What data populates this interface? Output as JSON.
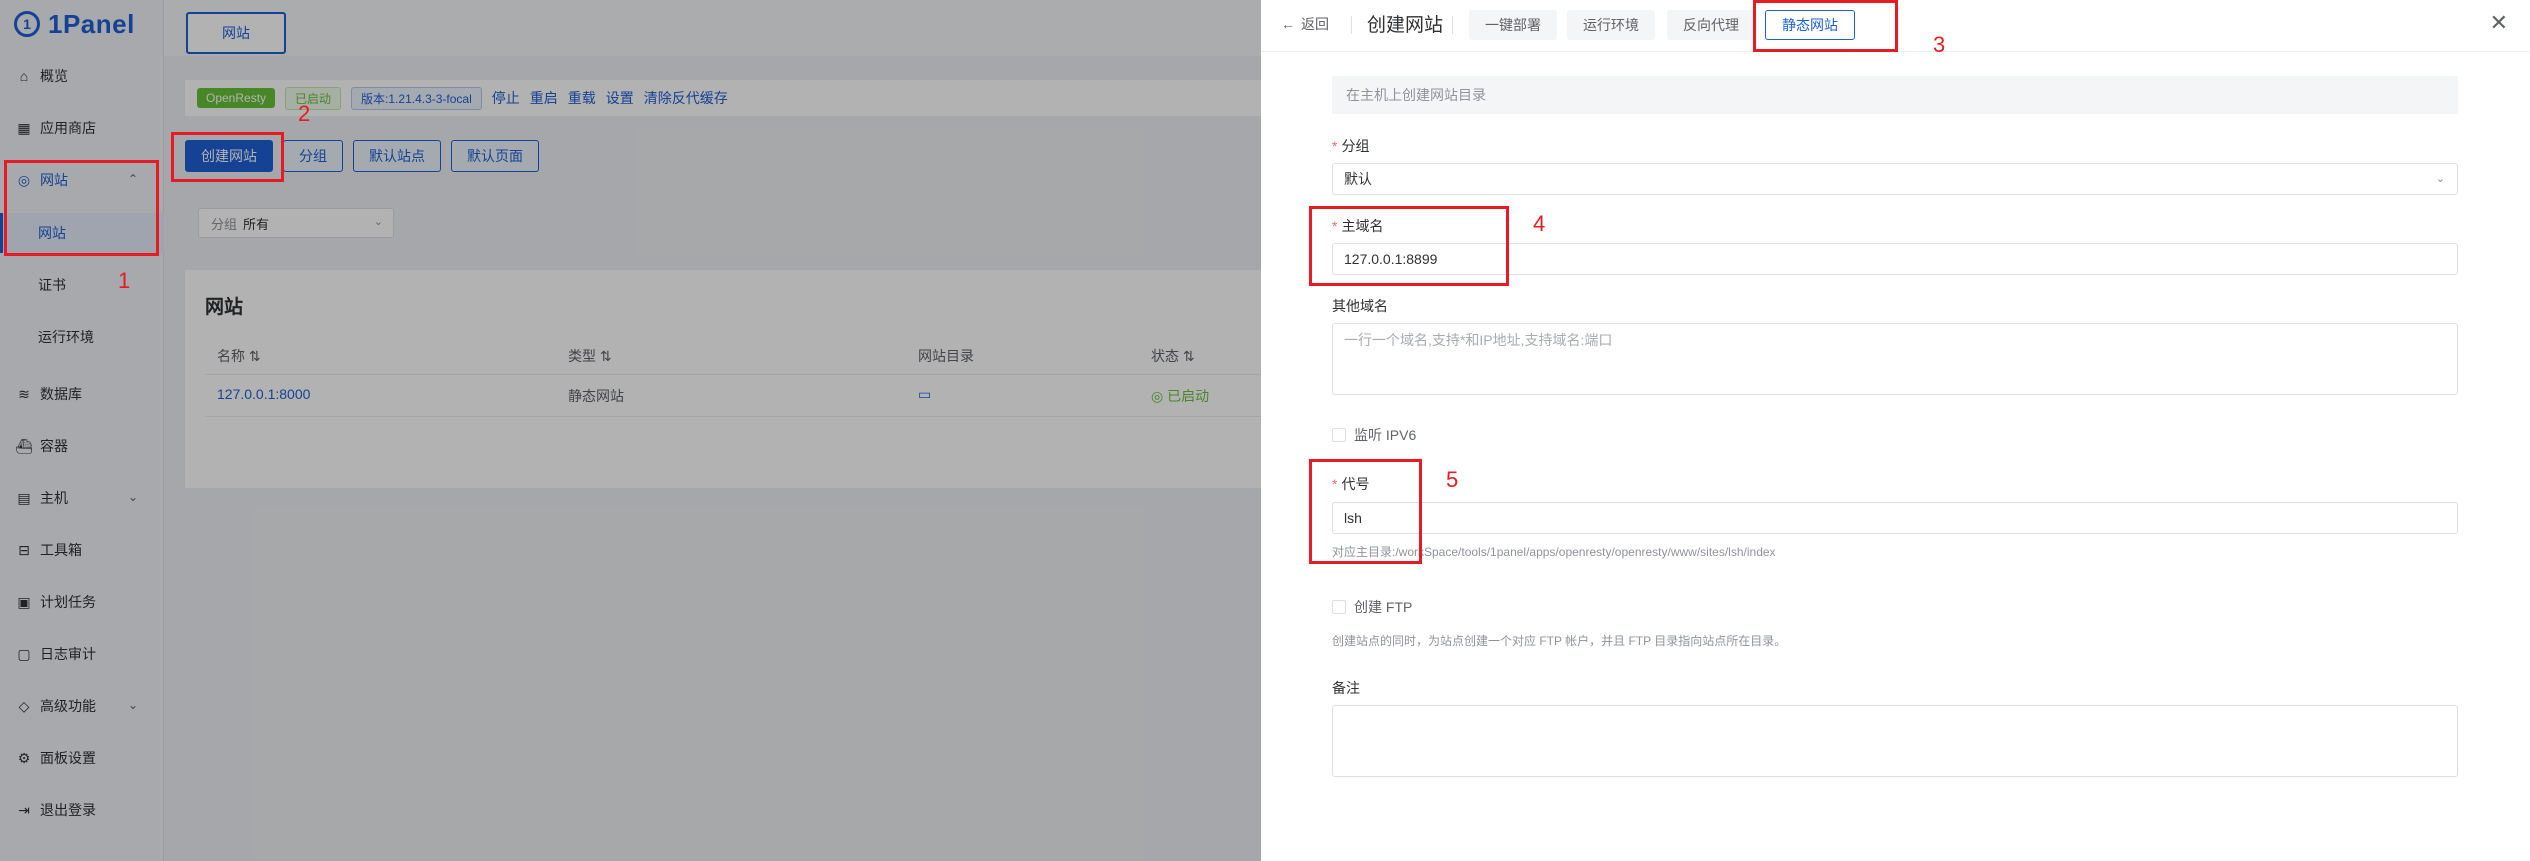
{
  "sidebar": {
    "logo_text": "1Panel",
    "items": [
      {
        "label": "概览",
        "icon": "home-icon"
      },
      {
        "label": "应用商店",
        "icon": "grid-icon"
      },
      {
        "label": "网站",
        "icon": "globe-icon"
      },
      {
        "label": "数据库",
        "icon": "database-icon"
      },
      {
        "label": "容器",
        "icon": "container-icon"
      },
      {
        "label": "主机",
        "icon": "server-icon"
      },
      {
        "label": "工具箱",
        "icon": "toolbox-icon"
      },
      {
        "label": "计划任务",
        "icon": "calendar-icon"
      },
      {
        "label": "日志审计",
        "icon": "log-icon"
      },
      {
        "label": "高级功能",
        "icon": "diamond-icon"
      },
      {
        "label": "面板设置",
        "icon": "gear-icon"
      },
      {
        "label": "退出登录",
        "icon": "logout-icon"
      }
    ],
    "subitems": [
      {
        "label": "网站"
      },
      {
        "label": "证书"
      },
      {
        "label": "运行环境"
      }
    ]
  },
  "main": {
    "top_tab": "网站",
    "status": {
      "app_tag": "OpenResty",
      "state_tag": "已启动",
      "version_tag": "版本:1.21.4.3-3-focal",
      "actions": [
        "停止",
        "重启",
        "重载",
        "设置",
        "清除反代缓存"
      ]
    },
    "buttons": {
      "create": "创建网站",
      "group": "分组",
      "default_site": "默认站点",
      "default_page": "默认页面"
    },
    "group_filter": {
      "label": "分组",
      "value": "所有"
    },
    "list": {
      "title": "网站",
      "columns": [
        "名称",
        "类型",
        "网站目录",
        "状态"
      ],
      "rows": [
        {
          "name": "127.0.0.1:8000",
          "type": "静态网站",
          "status": "已启动"
        }
      ]
    }
  },
  "drawer": {
    "back": "返回",
    "title": "创建网站",
    "tabs": [
      "一键部署",
      "运行环境",
      "反向代理",
      "静态网站"
    ],
    "hint": "在主机上创建网站目录",
    "group": {
      "label": "分组",
      "value": "默认"
    },
    "primary_domain": {
      "label": "主域名",
      "value": "127.0.0.1:8899"
    },
    "other_domains": {
      "label": "其他域名",
      "placeholder": "一行一个域名,支持*和IP地址,支持域名:端口"
    },
    "ipv6": {
      "label": "监听 IPV6"
    },
    "alias": {
      "label": "代号",
      "value": "lsh",
      "help": "对应主目录:/workSpace/tools/1panel/apps/openresty/openresty/www/sites/lsh/index"
    },
    "ftp": {
      "label": "创建 FTP",
      "help": "创建站点的同时，为站点创建一个对应 FTP 帐户，并且 FTP 目录指向站点所在目录。"
    },
    "remark": {
      "label": "备注"
    }
  },
  "annotations": [
    "1",
    "2",
    "3",
    "4",
    "5"
  ],
  "colors": {
    "brand": "#1f5fd6",
    "annotation": "#e51c23",
    "success": "#67c23a"
  }
}
